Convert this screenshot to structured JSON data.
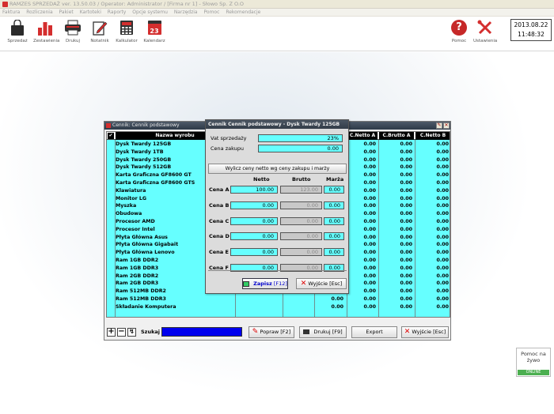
{
  "window_title": "RAMZES SPRZEDAŻ ver. 13.50.03 / Operator: Administrator / [Firma nr 1] - Słowo Sp. Z O.O",
  "menu": [
    "Faktura",
    "Rozliczenia",
    "Pakiet",
    "Kartoteki",
    "Raporty",
    "Opcje systemu",
    "Narzędzia",
    "Pomoc",
    "Rekomendacje"
  ],
  "toolbar": [
    {
      "label": "Sprzedaż",
      "icon": "shopping-bag-icon"
    },
    {
      "label": "Zestawienia",
      "icon": "bar-chart-icon"
    },
    {
      "label": "Drukuj",
      "icon": "printer-icon"
    },
    {
      "label": "Notatnik",
      "icon": "notepad-icon"
    },
    {
      "label": "Kalkulator",
      "icon": "calculator-icon"
    },
    {
      "label": "Kalendarz",
      "icon": "calendar-icon"
    }
  ],
  "calendar_day": "23",
  "toolbar_right": [
    {
      "label": "Pomoc",
      "icon": "help-icon"
    },
    {
      "label": "Ustawienia",
      "icon": "tools-icon"
    }
  ],
  "datetime": {
    "date": "2013.08.22",
    "time": "11:48:32"
  },
  "main_window": {
    "title": "Cennik: Cennik podstawowy",
    "columns": [
      "Nazwa wyrobu",
      "C.Netto A",
      "C.Brutto A",
      "C.Netto B"
    ],
    "products": [
      {
        "name": "Dysk Twardy 125GB",
        "netto_a": "0.00",
        "brutto_a": "0.00",
        "netto_b": "0.00"
      },
      {
        "name": "Dysk Twardy 1TB",
        "netto_a": "0.00",
        "brutto_a": "0.00",
        "netto_b": "0.00"
      },
      {
        "name": "Dysk Twardy 250GB",
        "netto_a": "0.00",
        "brutto_a": "0.00",
        "netto_b": "0.00"
      },
      {
        "name": "Dysk Twardy 512GB",
        "netto_a": "0.00",
        "brutto_a": "0.00",
        "netto_b": "0.00"
      },
      {
        "name": "Karta Graficzna GF8600 GT",
        "netto_a": "0.00",
        "brutto_a": "0.00",
        "netto_b": "0.00"
      },
      {
        "name": "Karta Graficzna GF8600 GTS",
        "netto_a": "0.00",
        "brutto_a": "0.00",
        "netto_b": "0.00"
      },
      {
        "name": "Klawiatura",
        "netto_a": "0.00",
        "brutto_a": "0.00",
        "netto_b": "0.00"
      },
      {
        "name": "Monitor LG",
        "netto_a": "0.00",
        "brutto_a": "0.00",
        "netto_b": "0.00"
      },
      {
        "name": "Myszka",
        "netto_a": "0.00",
        "brutto_a": "0.00",
        "netto_b": "0.00"
      },
      {
        "name": "Obudowa",
        "netto_a": "0.00",
        "brutto_a": "0.00",
        "netto_b": "0.00"
      },
      {
        "name": "Procesor AMD",
        "netto_a": "0.00",
        "brutto_a": "0.00",
        "netto_b": "0.00"
      },
      {
        "name": "Procesor Intel",
        "netto_a": "0.00",
        "brutto_a": "0.00",
        "netto_b": "0.00"
      },
      {
        "name": "Płyta Główna Asus",
        "netto_a": "0.00",
        "brutto_a": "0.00",
        "netto_b": "0.00"
      },
      {
        "name": "Płyta Główna Gigabait",
        "netto_a": "0.00",
        "brutto_a": "0.00",
        "netto_b": "0.00"
      },
      {
        "name": "Płyta Główna Lenovo",
        "netto_a": "0.00",
        "brutto_a": "0.00",
        "netto_b": "0.00"
      },
      {
        "name": "Ram 1GB DDR2",
        "netto_a": "0.00",
        "brutto_a": "0.00",
        "netto_b": "0.00"
      },
      {
        "name": "Ram 1GB DDR3",
        "netto_a": "0.00",
        "brutto_a": "0.00",
        "netto_b": "0.00"
      },
      {
        "name": "Ram 2GB DDR2",
        "netto_a": "0.00",
        "brutto_a": "0.00",
        "netto_b": "0.00"
      },
      {
        "name": "Ram 2GB DDR3",
        "netto_a": "0.00",
        "brutto_a": "0.00",
        "netto_b": "0.00"
      },
      {
        "name": "Ram 512MB DDR2",
        "netto_a": "0.00",
        "brutto_a": "0.00",
        "netto_b": "0.00"
      },
      {
        "name": "Ram 512MB DDR3",
        "netto_a": "0.00",
        "brutto_a": "0.00",
        "netto_b": "0.00"
      },
      {
        "name": "Składanie Komputera",
        "netto_a": "0.00",
        "brutto_a": "0.00",
        "netto_b": "0.00"
      }
    ],
    "search_label": "Szukaj",
    "search_value": "",
    "buttons": {
      "popraw": "Popraw",
      "popraw_key": "[F2]",
      "drukuj": "Drukuj",
      "drukuj_key": "[F9]",
      "export": "Export",
      "wyjscie": "Wyjście",
      "wyjscie_key": "[Esc]"
    }
  },
  "dialog": {
    "title": "Cennik Cennik podstawowy - Dysk Twardy 125GB",
    "vat_label": "Vat sprzedaży",
    "vat_value": "23%",
    "cost_label": "Cena zakupu",
    "cost_value": "0.00",
    "calc_button": "Wylicz ceny netto wg ceny zakupu i marży",
    "col_netto": "Netto",
    "col_brutto": "Brutto",
    "col_marza": "Marża",
    "rows": [
      {
        "label": "Cena A",
        "netto": "100.00",
        "brutto": "123.00",
        "marza": "0.00"
      },
      {
        "label": "Cena B",
        "netto": "0.00",
        "brutto": "0.00",
        "marza": "0.00"
      },
      {
        "label": "Cena C",
        "netto": "0.00",
        "brutto": "0.00",
        "marza": "0.00"
      },
      {
        "label": "Cena D",
        "netto": "0.00",
        "brutto": "0.00",
        "marza": "0.00"
      },
      {
        "label": "Cena E",
        "netto": "0.00",
        "brutto": "0.00",
        "marza": "0.00"
      },
      {
        "label": "Cena F",
        "netto": "0.00",
        "brutto": "0.00",
        "marza": "0.00"
      }
    ],
    "save_button": "Zapisz",
    "save_key": "[F12]",
    "exit_button": "Wyjście",
    "exit_key": "[Esc]"
  },
  "help_widget": {
    "title": "Pomoc na żywo",
    "status": "ONLINE"
  },
  "colors": {
    "cyan": "#66ffff",
    "accent_red": "#d42e2e",
    "header_black": "#000000",
    "title_dark": "#333c48",
    "online_green": "#4caf50"
  }
}
